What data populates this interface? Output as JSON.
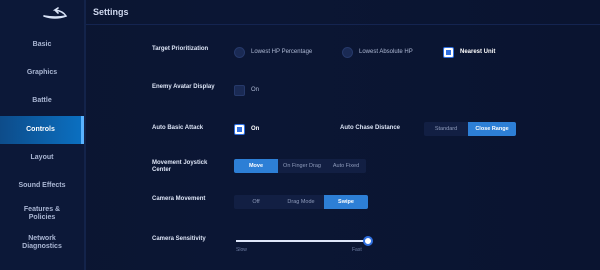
{
  "header": {
    "title": "Settings"
  },
  "sidebar": {
    "items": [
      {
        "label": "Basic",
        "active": false
      },
      {
        "label": "Graphics",
        "active": false
      },
      {
        "label": "Battle",
        "active": false
      },
      {
        "label": "Controls",
        "active": true
      },
      {
        "label": "Layout",
        "active": false
      },
      {
        "label": "Sound Effects",
        "active": false
      },
      {
        "label": "Features & Policies",
        "active": false
      },
      {
        "label": "Network Diagnostics",
        "active": false
      }
    ]
  },
  "settings": {
    "target_priority": {
      "label": "Target Prioritization",
      "options": [
        {
          "label": "Lowest HP Percentage",
          "selected": false
        },
        {
          "label": "Lowest Absolute HP",
          "selected": false
        },
        {
          "label": "Nearest Unit",
          "selected": true
        }
      ]
    },
    "enemy_avatar": {
      "label": "Enemy Avatar Display",
      "option": {
        "label": "On",
        "checked": false
      }
    },
    "auto_basic_attack": {
      "label": "Auto Basic Attack",
      "option": {
        "label": "On",
        "checked": true
      }
    },
    "auto_chase": {
      "label": "Auto Chase Distance",
      "options": [
        {
          "label": "Standard",
          "active": false
        },
        {
          "label": "Close Range",
          "active": true
        }
      ]
    },
    "joystick_center": {
      "label": "Movement Joystick Center",
      "options": [
        {
          "label": "Move",
          "active": true
        },
        {
          "label": "On Finger Drag",
          "active": false
        },
        {
          "label": "Auto Fixed",
          "active": false
        }
      ]
    },
    "camera_movement": {
      "label": "Camera Movement",
      "options": [
        {
          "label": "Off",
          "active": false
        },
        {
          "label": "Drag Mode",
          "active": false
        },
        {
          "label": "Swipe",
          "active": true
        }
      ]
    },
    "camera_sensitivity": {
      "label": "Camera Sensitivity",
      "min_label": "Slow",
      "max_label": "Fast",
      "value": 1.0
    }
  },
  "colors": {
    "accent": "#2d7fd6",
    "active_nav": "#0b6fc0",
    "background": "#0a1430"
  }
}
